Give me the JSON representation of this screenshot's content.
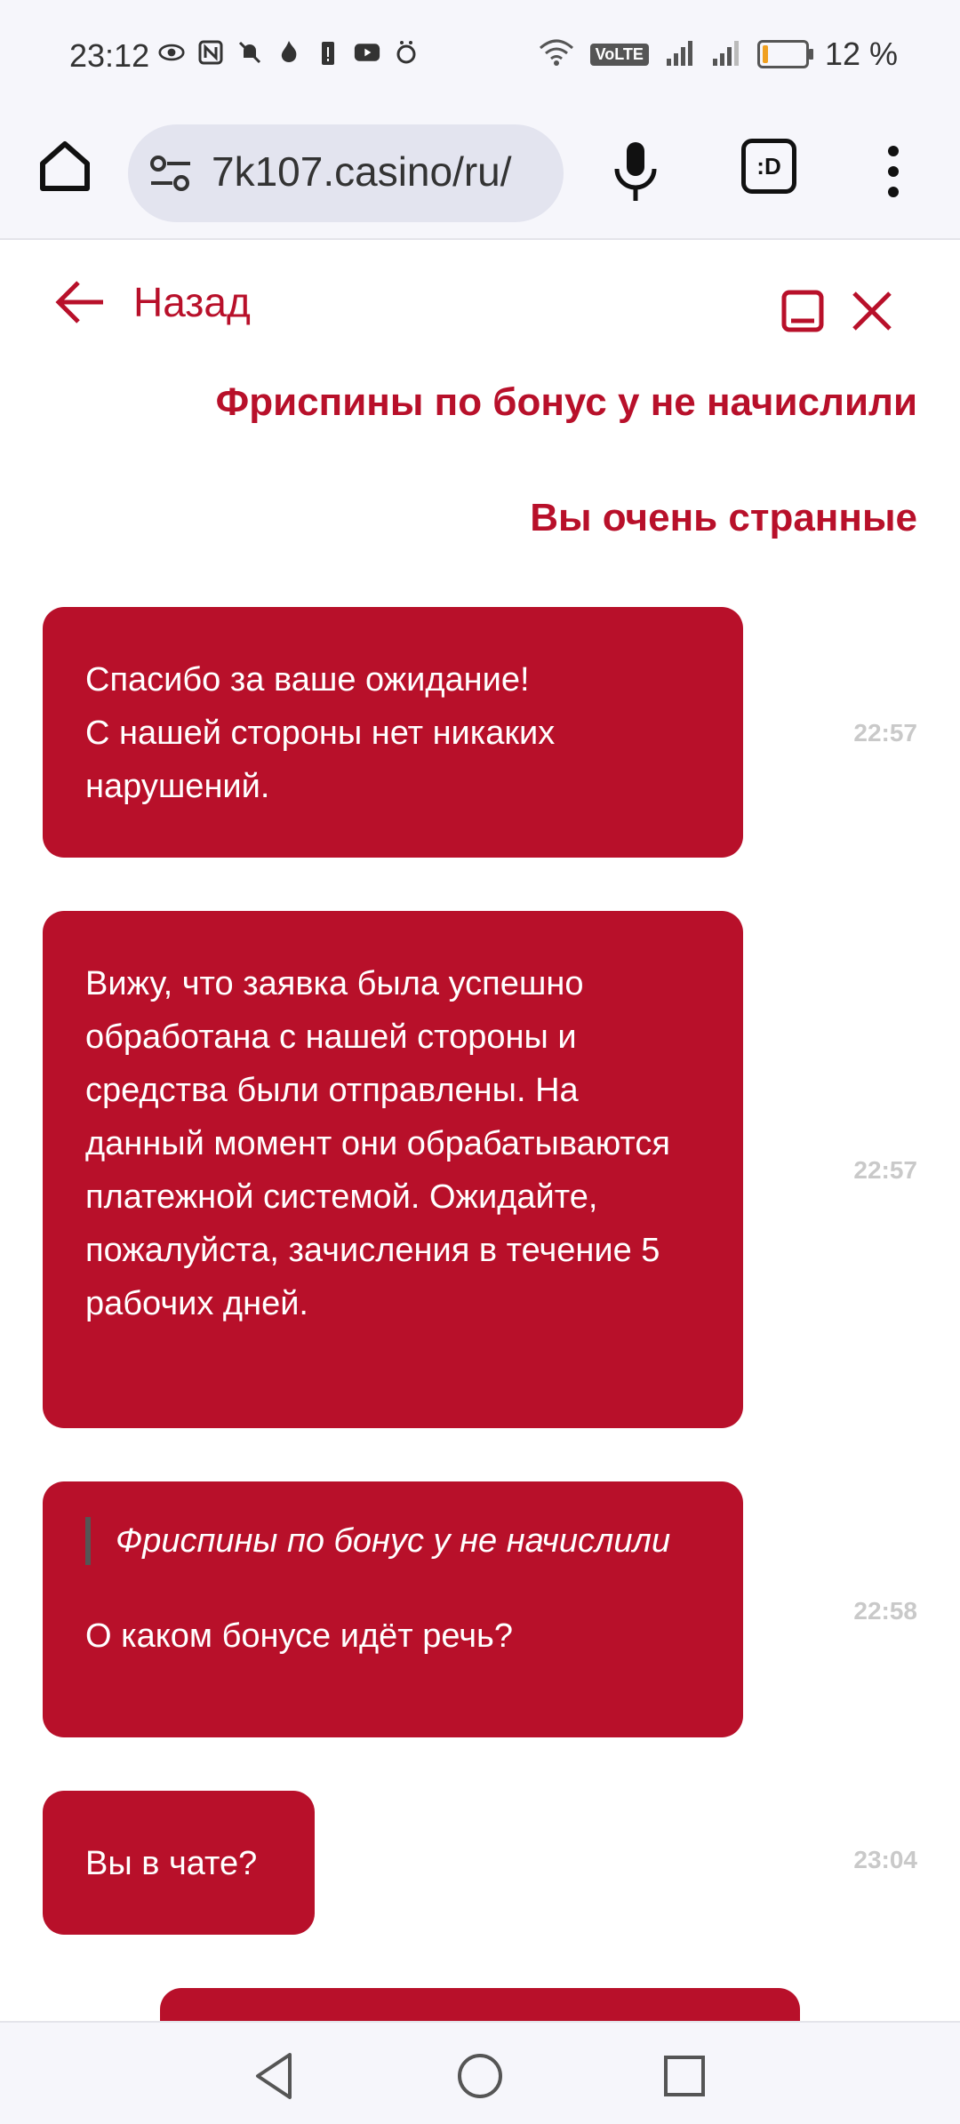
{
  "status_bar": {
    "time": "23:12",
    "icons": [
      "eye-icon",
      "nfc-icon",
      "bell-off-icon",
      "flame-icon",
      "battery-alert-icon",
      "youtube-icon",
      "app-icon"
    ],
    "volte": "VoLTE",
    "battery_text": "12 %",
    "battery_level": 0.12
  },
  "browser": {
    "url": "7k107.casino/ru/",
    "tab_label": ":D"
  },
  "chat": {
    "back_label": "Назад",
    "outgoing": [
      "Фриспины по бонус у не начислили",
      "Вы очень странные"
    ],
    "messages": [
      {
        "text": "Спасибо за ваше ожидание!\nС нашей стороны нет никаких нарушений.",
        "time": "22:57"
      },
      {
        "text": "Вижу, что заявка была успешно обработана с нашей стороны и средства были отправлены. На данный момент они обрабатываются платежной системой. Ожидайте, пожалуйста, зачисления в течение 5 рабочих дней.",
        "time": "22:57"
      },
      {
        "quote": "Фриспины по бонус у не начислили",
        "text": "О каком бонусе идёт речь?",
        "time": "22:58"
      },
      {
        "text": "Вы в чате?",
        "time": "23:04"
      }
    ]
  },
  "colors": {
    "accent": "#b8102a",
    "background": "#ffffff",
    "chrome": "#f6f6fb"
  }
}
